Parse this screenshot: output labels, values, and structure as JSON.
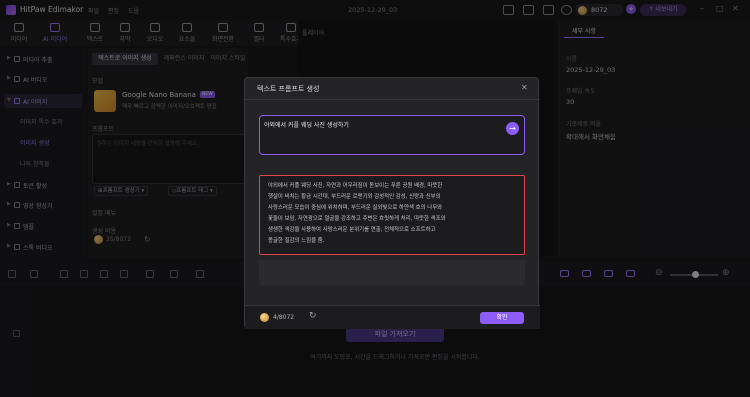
{
  "app": {
    "name": "HitPaw Edimakor",
    "menu": [
      "파일",
      "편집",
      "도움"
    ],
    "project_title": "2025-12-29_03"
  },
  "credits": {
    "count": "8072",
    "upgrade": "↑ 내보내기"
  },
  "toolbar": [
    "미디어",
    "AI 미디어",
    "텍스트",
    "자막",
    "오디오",
    "요소들",
    "화면전환",
    "필터",
    "특수효과"
  ],
  "sidebar": {
    "items": [
      "미디어 추출",
      "AI 비디오",
      "AI 이미지",
      "이미지 특수 효과",
      "이미지 생성",
      "나의 창작물",
      "토큰 활성",
      "영상 향상기",
      "템플",
      "스톡 비디오"
    ],
    "subitems": [
      "이미지 특수 효과",
      "이미지 생성",
      "나의 창작물"
    ]
  },
  "panel": {
    "tabs": [
      "텍스트로 이미지 생성",
      "레퍼런스 이미지",
      "이미지 스타일"
    ],
    "model_label": "모델",
    "model_name": "Google Nano Banana",
    "model_badge": "NEW",
    "model_desc": "매우 빠르고 강력한 이미지/오브젝트 편집",
    "prompt_label": "프롬프트",
    "prompt_placeholder": "원하는 이미지 내용을 간략히 설명해 주세요.",
    "btn_generate_prompt": "프롬프트 생성기",
    "btn_prompt_tag": "프롬프트 태그",
    "settings_label": "설정 메뉴",
    "generate_label": "생성 비용",
    "generate_cost": "35/8072"
  },
  "player": {
    "title": "플레이어"
  },
  "right_panel": {
    "tab": "세부 사항",
    "fields": [
      {
        "label": "이름",
        "value": "2025-12-29_03"
      },
      {
        "label": "프레임 속도",
        "value": "30"
      },
      {
        "label": "가로세로 비율",
        "value": "확대해서 화면채움"
      }
    ]
  },
  "timeline": {
    "import_button": "파일 가져오기",
    "hint": "여기까지 도망오, 시간을 드래그하거나 가져오면 편집을 시작합니다."
  },
  "modal": {
    "title": "텍스트 프롬프트 생성",
    "input_value": "야외에서 커플 웨딩 사진 생성하기",
    "result_lines": [
      "야외에서 커플 웨딩 사진, 자연과 어우러짐이 돋보이는 푸른 공원 배경, 따뜻한",
      "햇살이 비치는 황금 시간대, 부드러운 로맨기와 감성적인 감성, 신랑과 신부의",
      "사랑스러운 모습이 중심에 위치하며, 부드러운 실외빛으로 하얀색 호의 나무와",
      "꽃들이 보임, 자연광으로 얼굴을 강조하고 주변은 흐릿하게 처리, 따뜻한 색조와",
      "생생한 색감을 사용하여 사랑스러운 분위기를 연출, 전체적으로 소프트하고",
      "몽글한 질감의 느낌을 줌."
    ],
    "footer_credits": "4/8072",
    "confirm": "확인"
  }
}
